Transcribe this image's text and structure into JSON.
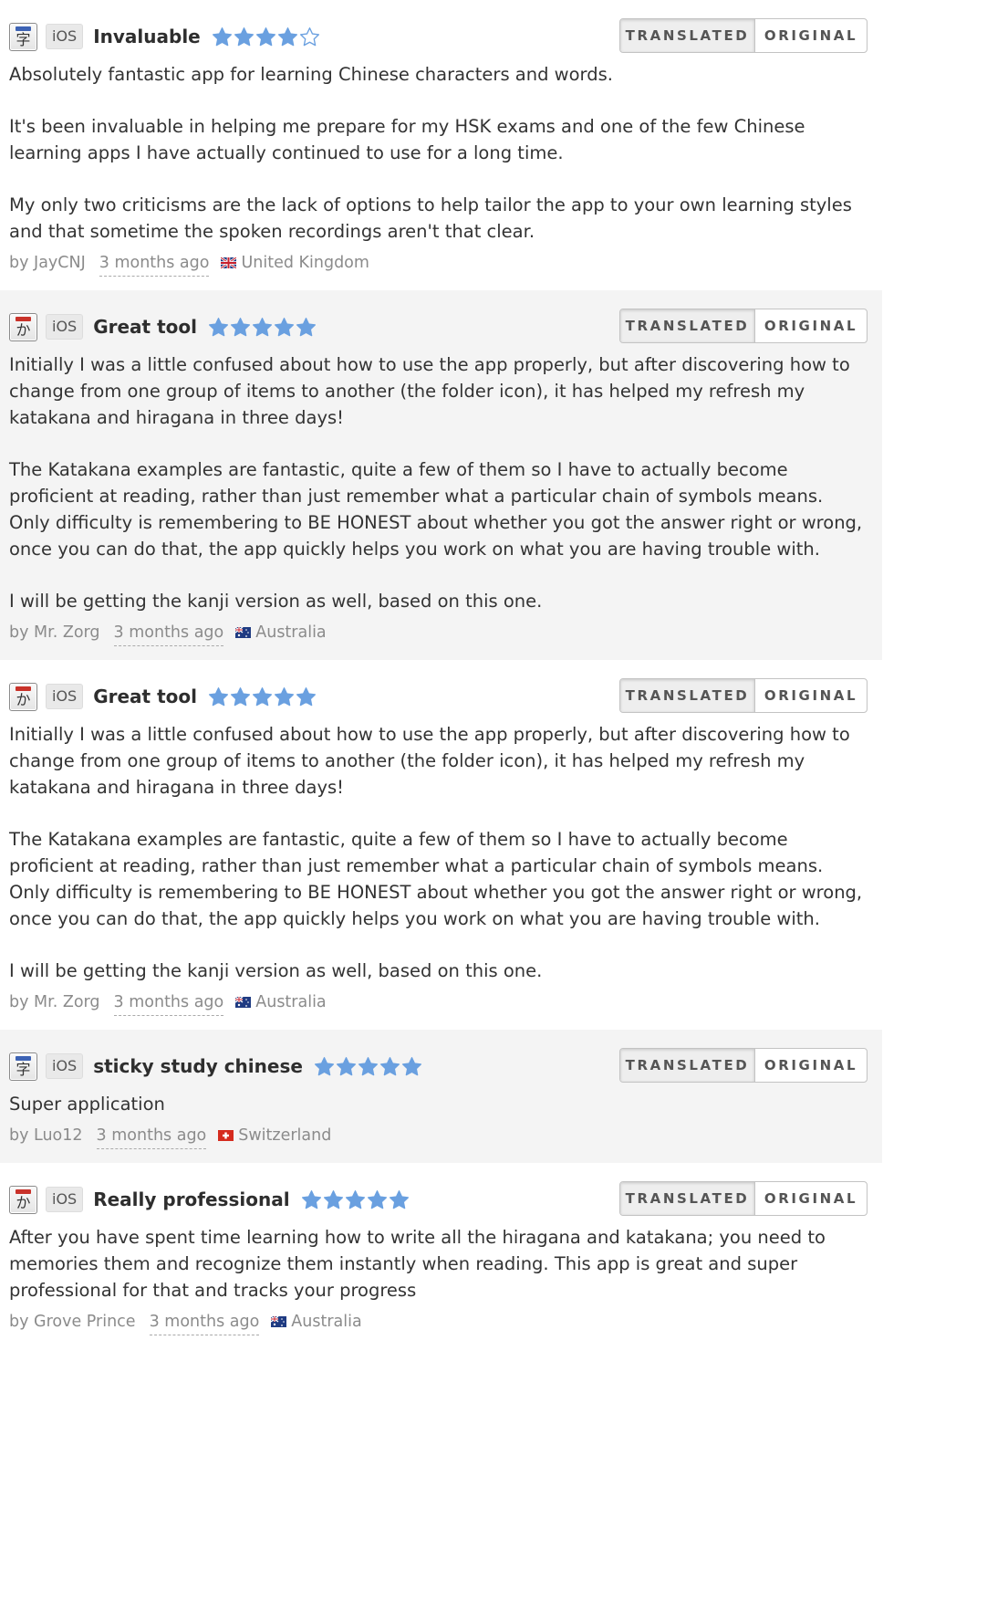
{
  "reviews": [
    {
      "icon_glyph": "字",
      "icon_kind": "hanzi",
      "platform": "iOS",
      "title": "Invaluable",
      "rating": 4,
      "translated_label": "TRANSLATED",
      "original_label": "ORIGINAL",
      "paragraphs": [
        "Absolutely fantastic app for learning Chinese characters and words.",
        "It's been invaluable in helping me prepare for my HSK exams and one of the few Chinese learning apps I have actually continued to use for a long time.",
        "My only two criticisms are the lack of options to help tailor the app to your own learning styles and that sometime the spoken recordings aren't that clear."
      ],
      "author": "by JayCNJ",
      "when": "3 months ago",
      "flag": "uk-flag-icon",
      "country": "United Kingdom"
    },
    {
      "icon_glyph": "か",
      "icon_kind": "kana",
      "platform": "iOS",
      "title": "Great tool",
      "rating": 5,
      "translated_label": "TRANSLATED",
      "original_label": "ORIGINAL",
      "paragraphs": [
        "Initially I was a little confused about how to use the app properly, but after discovering how to change from one group of items to another (the folder icon), it has helped my refresh my katakana and hiragana in three days!",
        "The Katakana examples are fantastic, quite a few of them so I have to actually become proficient at reading, rather than just remember what a particular chain of symbols means. Only difficulty is remembering to BE HONEST about whether you got the answer right or wrong, once you can do that, the app quickly helps you work on what you are having trouble with.",
        "I will be getting the kanji version as well, based on this one."
      ],
      "author": "by Mr. Zorg",
      "when": "3 months ago",
      "flag": "australia-flag-icon",
      "country": "Australia"
    },
    {
      "icon_glyph": "か",
      "icon_kind": "kana",
      "platform": "iOS",
      "title": "Great tool",
      "rating": 5,
      "translated_label": "TRANSLATED",
      "original_label": "ORIGINAL",
      "paragraphs": [
        "Initially I was a little confused about how to use the app properly, but after discovering how to change from one group of items to another (the folder icon), it has helped my refresh my katakana and hiragana in three days!",
        "The Katakana examples are fantastic, quite a few of them so I have to actually become proficient at reading, rather than just remember what a particular chain of symbols means. Only difficulty is remembering to BE HONEST about whether you got the answer right or wrong, once you can do that, the app quickly helps you work on what you are having trouble with.",
        "I will be getting the kanji version as well, based on this one."
      ],
      "author": "by Mr. Zorg",
      "when": "3 months ago",
      "flag": "australia-flag-icon",
      "country": "Australia"
    },
    {
      "icon_glyph": "字",
      "icon_kind": "hanzi",
      "platform": "iOS",
      "title": "sticky study chinese",
      "rating": 5,
      "translated_label": "TRANSLATED",
      "original_label": "ORIGINAL",
      "paragraphs": [
        "Super application"
      ],
      "author": "by Luo12",
      "when": "3 months ago",
      "flag": "switzerland-flag-icon",
      "country": "Switzerland"
    },
    {
      "icon_glyph": "か",
      "icon_kind": "kana",
      "platform": "iOS",
      "title": "Really professional",
      "rating": 5,
      "translated_label": "TRANSLATED",
      "original_label": "ORIGINAL",
      "paragraphs": [
        "After you have spent time learning how to write all the hiragana and katakana; you need to memories them and recognize them instantly when reading. This app is great and super professional for that and tracks your progress"
      ],
      "author": "by Grove Prince",
      "when": "3 months ago",
      "flag": "australia-flag-icon",
      "country": "Australia"
    }
  ],
  "colors": {
    "star_fill": "#6aa0e0",
    "star_outline": "#6aa0e0",
    "alt_background": "#f4f4f4",
    "text": "#333333",
    "meta": "#8b8b8b"
  }
}
